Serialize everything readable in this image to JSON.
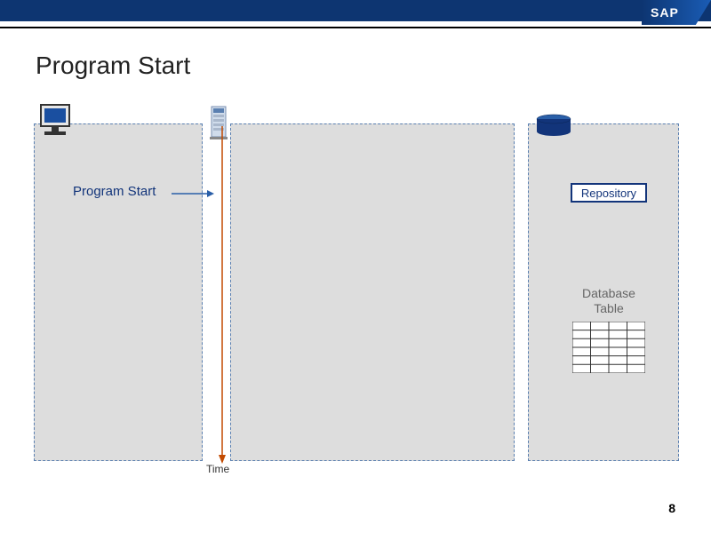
{
  "brand": {
    "logo_text": "SAP"
  },
  "colors": {
    "header": "#0d3571",
    "accent": "#12347a",
    "time_line": "#c34a00",
    "arrow": "#2a5fa8",
    "db_cyl": "#2a5fa8",
    "panel_bg": "#dddddd"
  },
  "slide": {
    "title": "Program Start",
    "page_number": "8",
    "labels": {
      "program_start": "Program Start",
      "repository": "Repository",
      "database_table": "Database Table",
      "time": "Time"
    },
    "icons": {
      "client": "computer-icon",
      "server": "server-icon",
      "database": "database-cylinder-icon"
    },
    "table_grid": {
      "rows": 6,
      "cols": 4
    }
  }
}
